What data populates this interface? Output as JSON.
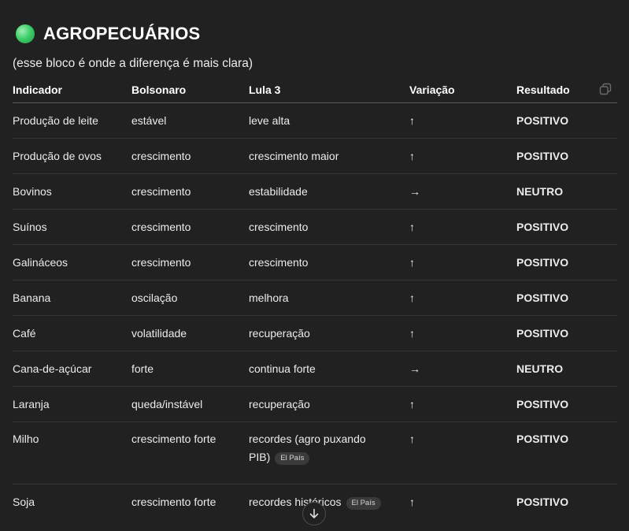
{
  "section": {
    "title": "AGROPECUÁRIOS",
    "subtitle": "(esse bloco é onde a diferença é mais clara)"
  },
  "table": {
    "headers": [
      "Indicador",
      "Bolsonaro",
      "Lula 3",
      "Variação",
      "Resultado"
    ],
    "rows": [
      {
        "indicador": "Produção de leite",
        "bolsonaro": "estável",
        "lula": "leve alta",
        "variacao": "↑",
        "resultado": "POSITIVO"
      },
      {
        "indicador": "Produção de ovos",
        "bolsonaro": "crescimento",
        "lula": "crescimento maior",
        "variacao": "↑",
        "resultado": "POSITIVO"
      },
      {
        "indicador": "Bovinos",
        "bolsonaro": "crescimento",
        "lula": "estabilidade",
        "variacao": "→",
        "resultado": "NEUTRO"
      },
      {
        "indicador": "Suínos",
        "bolsonaro": "crescimento",
        "lula": "crescimento",
        "variacao": "↑",
        "resultado": "POSITIVO"
      },
      {
        "indicador": "Galináceos",
        "bolsonaro": "crescimento",
        "lula": "crescimento",
        "variacao": "↑",
        "resultado": "POSITIVO"
      },
      {
        "indicador": "Banana",
        "bolsonaro": "oscilação",
        "lula": "melhora",
        "variacao": "↑",
        "resultado": "POSITIVO"
      },
      {
        "indicador": "Café",
        "bolsonaro": "volatilidade",
        "lula": "recuperação",
        "variacao": "↑",
        "resultado": "POSITIVO"
      },
      {
        "indicador": "Cana-de-açúcar",
        "bolsonaro": "forte",
        "lula": "continua forte",
        "variacao": "→",
        "resultado": "NEUTRO"
      },
      {
        "indicador": "Laranja",
        "bolsonaro": "queda/instável",
        "lula": "recuperação",
        "variacao": "↑",
        "resultado": "POSITIVO"
      },
      {
        "indicador": "Milho",
        "bolsonaro": "crescimento forte",
        "lula_line1": "recordes (agro puxando",
        "lula_line2": "PIB)",
        "source": "El País",
        "variacao": "↑",
        "resultado": "POSITIVO"
      },
      {
        "indicador": "Soja",
        "bolsonaro": "crescimento forte",
        "lula": "recordes históricos",
        "source": "El País",
        "variacao": "↑",
        "resultado": "POSITIVO"
      }
    ]
  },
  "icons": {
    "status_dot": "green-circle-icon",
    "copy": "copy-icon",
    "scroll_down": "arrow-down-icon"
  },
  "colors": {
    "background": "#212121",
    "status_dot": "#3fce6a"
  }
}
